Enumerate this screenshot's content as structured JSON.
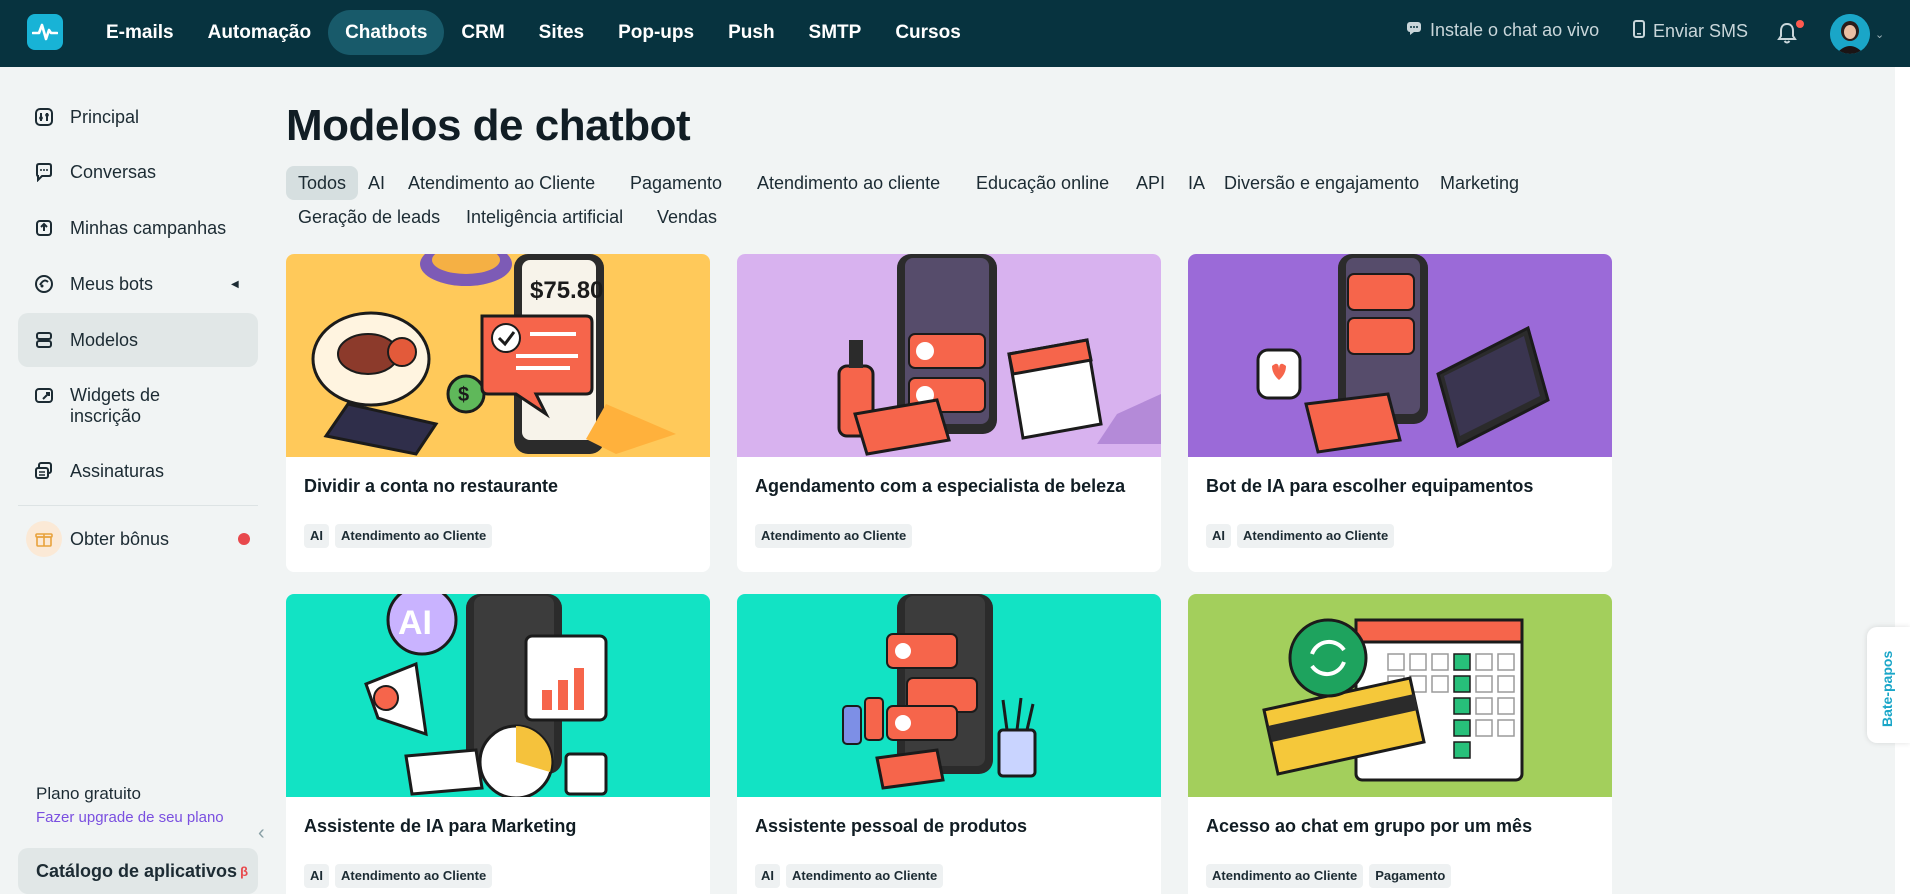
{
  "topnav": {
    "items": [
      "E-mails",
      "Automação",
      "Chatbots",
      "CRM",
      "Sites",
      "Pop-ups",
      "Push",
      "SMTP",
      "Cursos"
    ],
    "active": "Chatbots",
    "install_chat": "Instale o chat ao vivo",
    "send_sms": "Enviar SMS"
  },
  "sidebar": {
    "items": [
      {
        "label": "Principal",
        "icon": "dashboard-icon"
      },
      {
        "label": "Conversas",
        "icon": "chat-bubble-icon"
      },
      {
        "label": "Minhas campanhas",
        "icon": "campaign-icon"
      },
      {
        "label": "Meus bots",
        "icon": "bot-icon"
      },
      {
        "label": "Modelos",
        "icon": "templates-icon"
      },
      {
        "label": "Widgets de inscrição",
        "icon": "widget-icon"
      },
      {
        "label": "Assinaturas",
        "icon": "subscriptions-icon"
      },
      {
        "label": "Obter bônus",
        "icon": "gift-icon"
      }
    ],
    "active": "Modelos",
    "plan_title": "Plano gratuito",
    "plan_upgrade": "Fazer upgrade de seu plano",
    "catalog": "Catálogo de aplicativos",
    "catalog_badge": "β"
  },
  "main": {
    "title": "Modelos de chatbot",
    "filters": [
      "Todos",
      "AI",
      "Atendimento ao Cliente",
      "Pagamento",
      "Atendimento ao cliente",
      "Educação online",
      "API",
      "IA",
      "Diversão e engajamento",
      "Marketing",
      "Geração de leads",
      "Inteligência artificial",
      "Vendas"
    ],
    "active_filter": "Todos",
    "cards": [
      {
        "title": "Dividir a conta no restaurante",
        "tags": [
          "AI",
          "Atendimento ao Cliente"
        ],
        "bg": "#ffc95a",
        "image_text": "$75.80"
      },
      {
        "title": "Agendamento com a especialista de beleza",
        "tags": [
          "Atendimento ao Cliente"
        ],
        "bg": "#d8b2ef"
      },
      {
        "title": "Bot de IA para escolher equipamentos",
        "tags": [
          "AI",
          "Atendimento ao Cliente"
        ],
        "bg": "#9b6ad8"
      },
      {
        "title": "Assistente de IA para Marketing",
        "tags": [
          "AI",
          "Atendimento ao Cliente"
        ],
        "bg": "#12e3c4",
        "image_text": "AI"
      },
      {
        "title": "Assistente pessoal de produtos",
        "tags": [
          "AI",
          "Atendimento ao Cliente"
        ],
        "bg": "#12e3c4"
      },
      {
        "title": "Acesso ao chat em grupo por um mês",
        "tags": [
          "Atendimento ao Cliente",
          "Pagamento"
        ],
        "bg": "#a3cf5c"
      }
    ]
  },
  "side_tab": "Bate-papos"
}
